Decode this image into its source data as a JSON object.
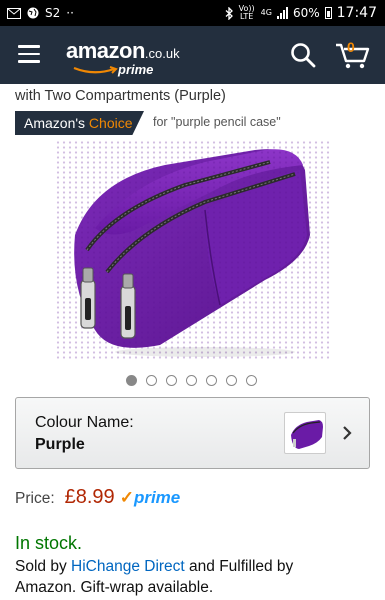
{
  "status_bar": {
    "left_text": "S2",
    "volte": "Vo)) LTE",
    "network": "4G",
    "battery": "60%",
    "time": "17:47"
  },
  "header": {
    "logo_text": "amazon",
    "logo_tld": ".co.uk",
    "logo_sub": "prime",
    "cart_count": "0",
    "bg_color": "#232f3e"
  },
  "product": {
    "title_tail": "with Two Compartments (Purple)",
    "badge_prefix": "Amazon's",
    "badge_choice": "Choice",
    "badge_for": "for \"purple pencil case\"",
    "image_count": 7,
    "active_image": 1
  },
  "colour": {
    "label": "Colour Name:",
    "value": "Purple"
  },
  "price": {
    "label": "Price:",
    "value": "£8.99",
    "prime_check": "✓",
    "prime_word": "prime"
  },
  "availability": {
    "stock": "In stock.",
    "sold_by_prefix": "Sold by",
    "seller": "HiChange Direct",
    "sold_by_suffix": "and Fulfilled by Amazon. Gift-wrap available."
  }
}
